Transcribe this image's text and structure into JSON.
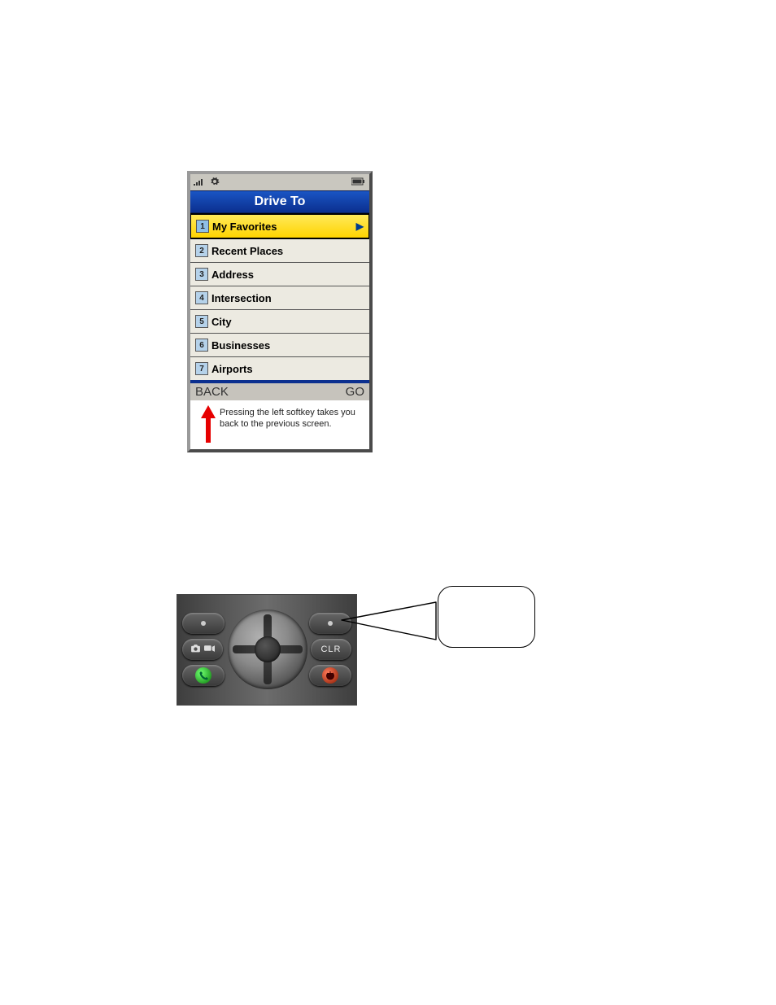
{
  "device": {
    "title": "Drive To",
    "status": {
      "signal_label": "signal",
      "gear_label": "settings",
      "battery_label": "battery"
    },
    "menu": [
      {
        "num": "1",
        "label": "My Favorites",
        "selected": true,
        "hasArrow": true
      },
      {
        "num": "2",
        "label": "Recent Places",
        "selected": false,
        "hasArrow": false
      },
      {
        "num": "3",
        "label": "Address",
        "selected": false,
        "hasArrow": false
      },
      {
        "num": "4",
        "label": "Intersection",
        "selected": false,
        "hasArrow": false
      },
      {
        "num": "5",
        "label": "City",
        "selected": false,
        "hasArrow": false
      },
      {
        "num": "6",
        "label": "Businesses",
        "selected": false,
        "hasArrow": false
      },
      {
        "num": "7",
        "label": "Airports",
        "selected": false,
        "hasArrow": false
      }
    ],
    "softkeys": {
      "left": "BACK",
      "right": "GO"
    },
    "hint": "Pressing the left softkey takes you back to the previous screen."
  },
  "keypad": {
    "clr_label": "CLR",
    "camera_icon_label": "camera",
    "video_icon_label": "video-camera",
    "call_label": "call",
    "end_label": "end-call",
    "top_left_dot": "softkey-left",
    "top_right_dot": "softkey-right"
  },
  "callout": {
    "text": ""
  }
}
